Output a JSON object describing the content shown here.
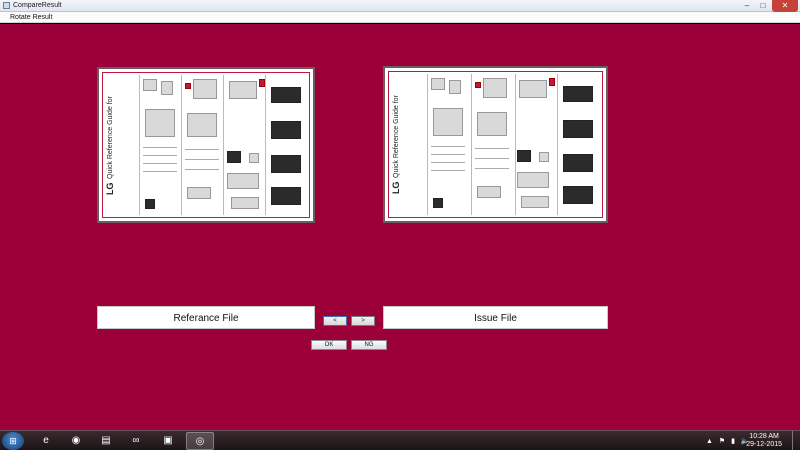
{
  "window": {
    "title": "CompareResult",
    "controls": {
      "minimize": "–",
      "maximize": "□",
      "close": "✕"
    }
  },
  "menu": {
    "rotate_result": "Rotate Result"
  },
  "thumbnails": {
    "reference": {
      "doc_title": "Quick Reference Guide for",
      "brand": "LG"
    },
    "issue": {
      "doc_title": "Quick Reference Guide for",
      "brand": "LG"
    }
  },
  "labels": {
    "reference_file": "Referance File",
    "issue_file": "Issue File"
  },
  "nav": {
    "prev": "<",
    "next": ">"
  },
  "actions": {
    "ok": "OK",
    "ng": "NG"
  },
  "taskbar": {
    "start_icon": "windows-start-icon",
    "tray_icons": "▲ ⚑ ▮ 🔈",
    "time": "10:28 AM",
    "date": "29-12-2015"
  },
  "colors": {
    "background": "#9c0038",
    "accent": "#c0173c"
  }
}
